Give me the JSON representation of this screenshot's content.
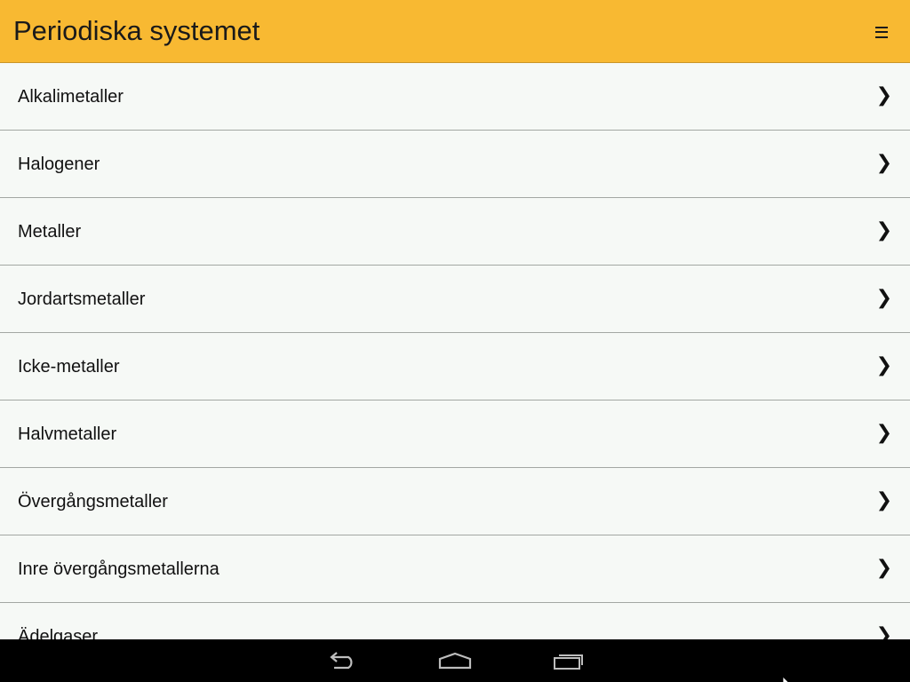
{
  "app_bar": {
    "title": "Periodiska systemet",
    "menu_icon": "hamburger-menu-icon",
    "background_color": "#f8b932"
  },
  "list": {
    "items": [
      {
        "label": "Alkalimetaller",
        "icon": "chevron-right-icon",
        "glyph": "❯"
      },
      {
        "label": "Halogener",
        "icon": "chevron-right-icon",
        "glyph": "❯"
      },
      {
        "label": "Metaller",
        "icon": "chevron-right-icon",
        "glyph": "❯"
      },
      {
        "label": "Jordartsmetaller",
        "icon": "chevron-right-icon",
        "glyph": "❯"
      },
      {
        "label": "Icke-metaller",
        "icon": "chevron-right-icon",
        "glyph": "❯"
      },
      {
        "label": "Halvmetaller",
        "icon": "chevron-right-icon",
        "glyph": "❯"
      },
      {
        "label": "Övergångsmetaller",
        "icon": "chevron-right-icon",
        "glyph": "❯"
      },
      {
        "label": "Inre övergångsmetallerna",
        "icon": "chevron-right-icon",
        "glyph": "❯"
      },
      {
        "label": "Ädelgaser",
        "icon": "chevron-right-icon",
        "glyph": "❯"
      }
    ]
  },
  "system_nav": {
    "back_icon": "back-icon",
    "home_icon": "home-icon",
    "recents_icon": "recent-apps-icon",
    "background_color": "#000000"
  }
}
